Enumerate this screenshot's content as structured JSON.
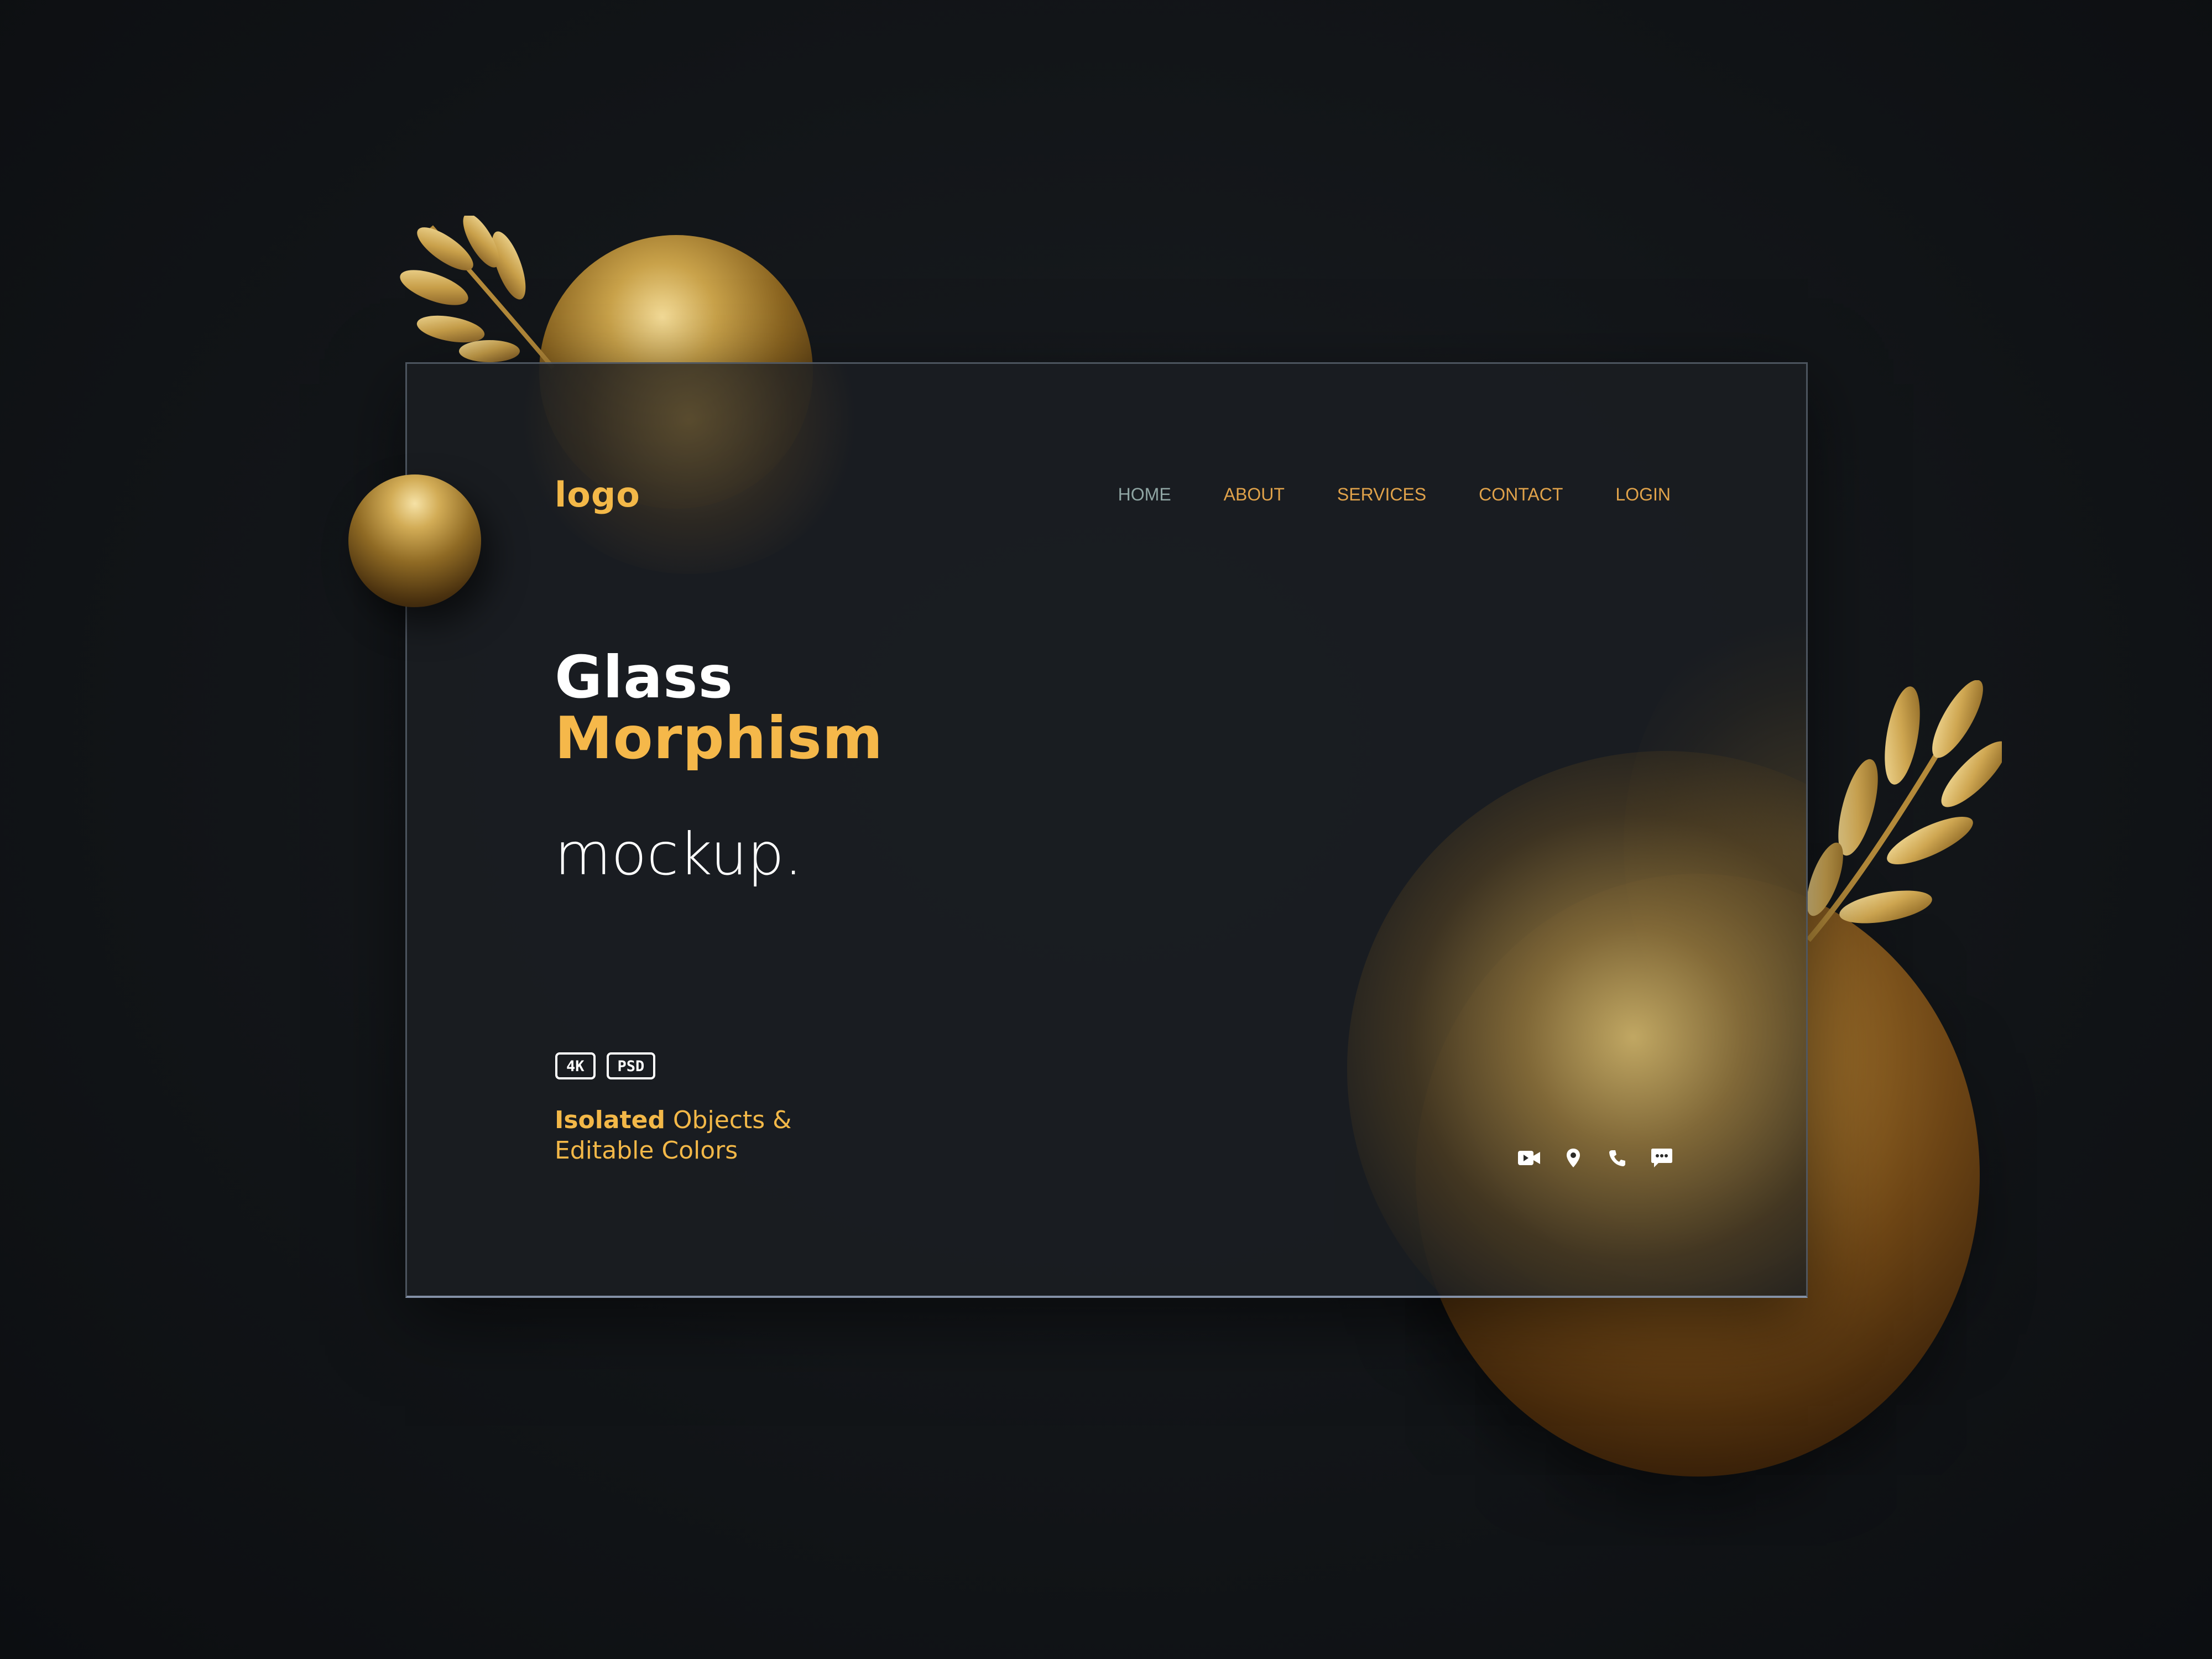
{
  "header": {
    "logo": "logo",
    "nav": [
      "HOME",
      "ABOUT",
      "SERVICES",
      "CONTACT",
      "LOGIN"
    ],
    "active_item": "HOME"
  },
  "hero": {
    "line1": "Glass",
    "line2": "Morphism",
    "sub": "mockup."
  },
  "badges": [
    "4K",
    "PSD"
  ],
  "tagline": {
    "bold": "Isolated",
    "rest_line1": " Objects &",
    "line2": "Editable Colors"
  },
  "contact_icons": [
    "video-icon",
    "location-pin-icon",
    "phone-icon",
    "chat-icon"
  ],
  "colors": {
    "accent_gold": "#f3b848",
    "nav_active": "#8fa5a3",
    "background": "#121518"
  }
}
